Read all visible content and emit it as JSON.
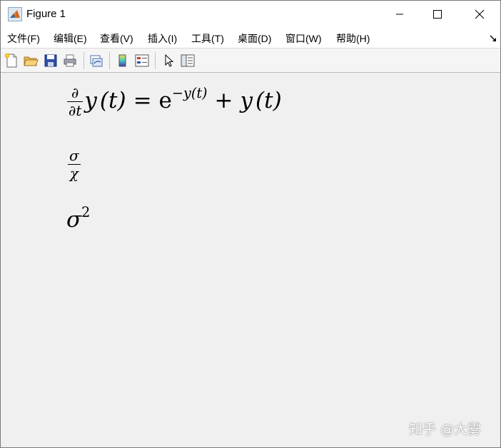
{
  "window": {
    "title": "Figure 1"
  },
  "menu": {
    "items": [
      "文件(F)",
      "编辑(E)",
      "查看(V)",
      "插入(I)",
      "工具(T)",
      "桌面(D)",
      "窗口(W)",
      "帮助(H)"
    ]
  },
  "toolbar": {
    "icons": [
      "new-figure-icon",
      "open-icon",
      "save-icon",
      "print-icon",
      "link-plot-icon",
      "colorbar-icon",
      "legend-icon",
      "pointer-icon",
      "property-inspector-icon"
    ]
  },
  "canvas": {
    "background": "#f0f0f0",
    "equations": {
      "eq1": {
        "frac_num": "∂",
        "frac_den": "∂t",
        "y1": "y",
        "t1": "(t)",
        "equals": "=",
        "e": "e",
        "exponent": "−y(t)",
        "plus": "+",
        "y2": "y",
        "t2": "(t)"
      },
      "eq2": {
        "frac_num": "σ",
        "frac_den": "χ"
      },
      "eq3": {
        "base": "σ",
        "exponent": "2"
      }
    },
    "watermark": "知乎 @大雾"
  }
}
